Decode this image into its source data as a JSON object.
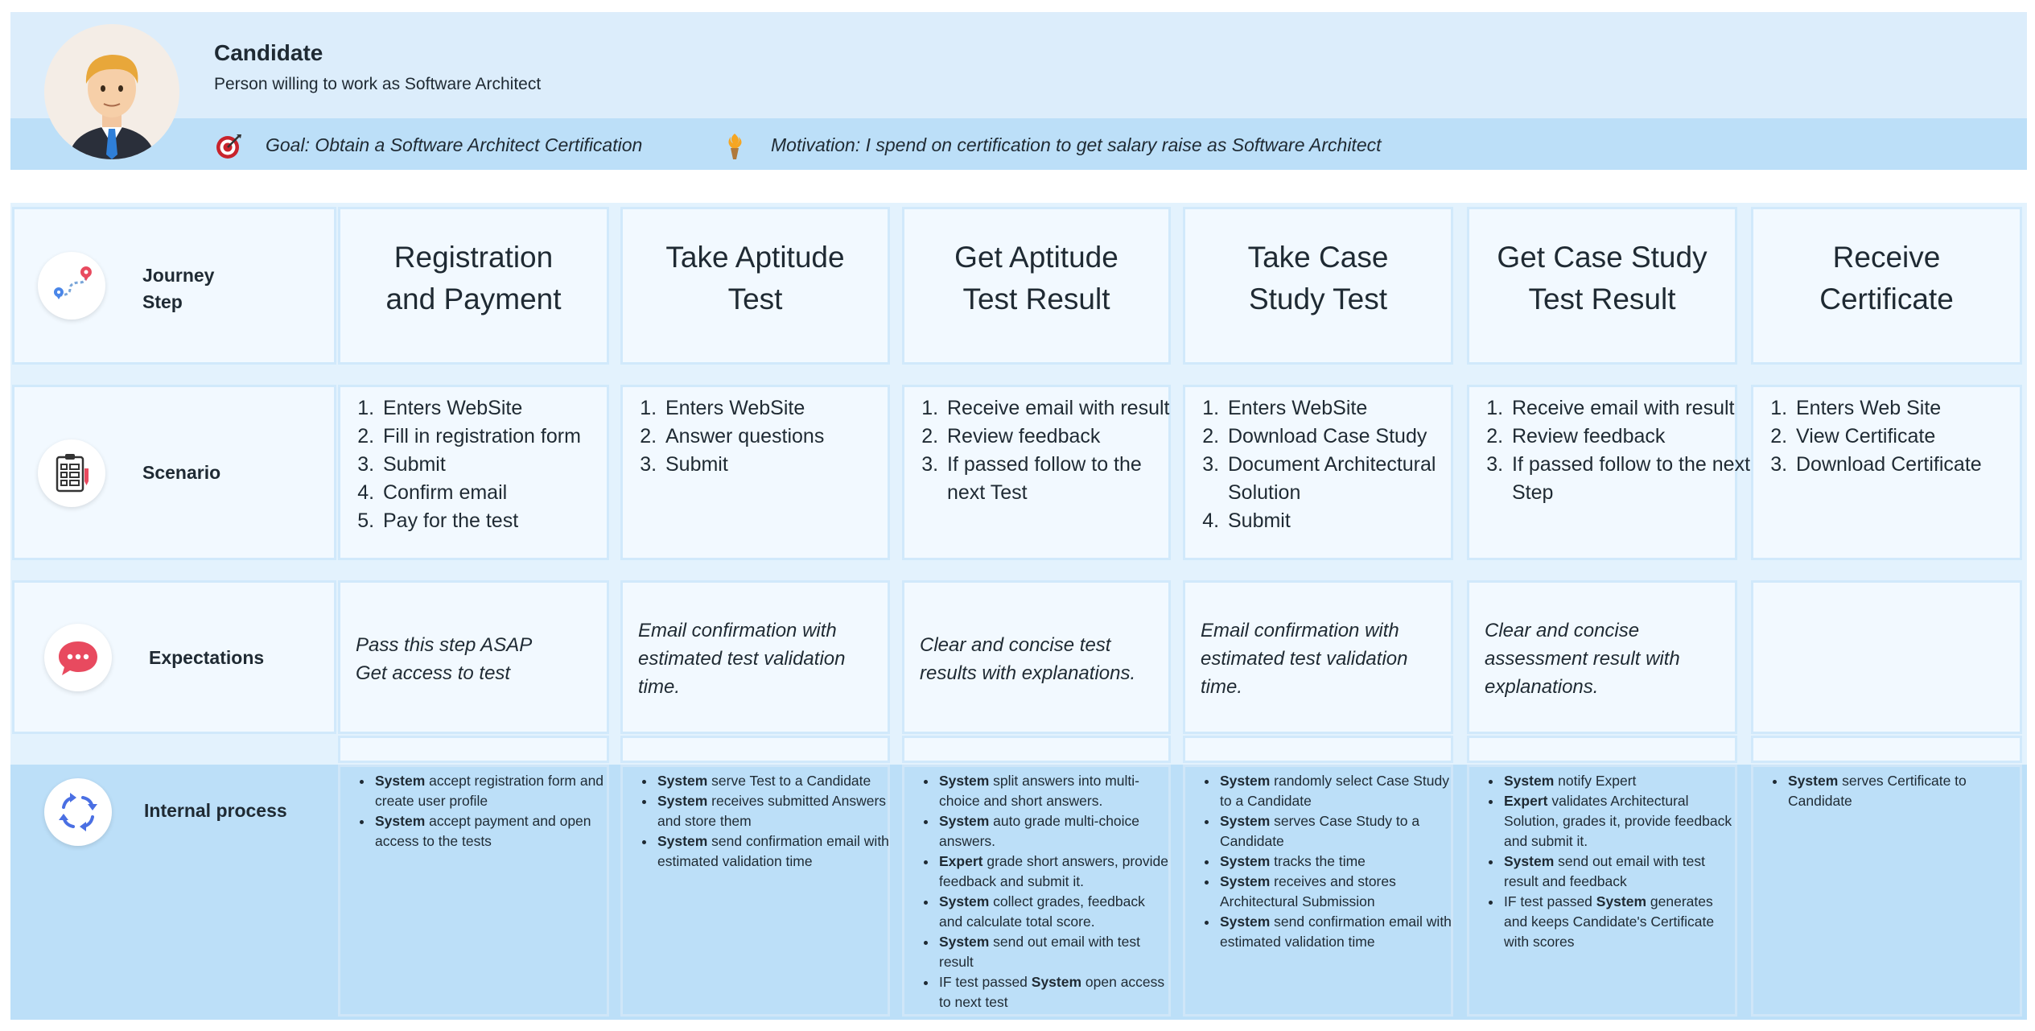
{
  "persona": {
    "name": "Candidate",
    "description": "Person willing to work as Software Architect",
    "goal": "Goal: Obtain a Software Architect Certification",
    "motivation": "Motivation: I spend on certification to get salary raise as Software Architect"
  },
  "row_labels": {
    "journey_step": "Journey\nStep",
    "scenario": "Scenario",
    "expectations": "Expectations",
    "internal_process": "Internal process"
  },
  "icons": {
    "journey": "route-map-pin-icon",
    "scenario": "checklist-icon",
    "expectations": "chat-bubble-icon",
    "process": "refresh-arrows-icon",
    "goal": "target-icon",
    "motivation": "torch-icon"
  },
  "colors": {
    "header_bg": "#dcedfb",
    "header_band": "#bcdff8",
    "cell_bg": "#f2f9ff",
    "process_bg": "#bcdff8",
    "accent_red": "#e84a5f",
    "accent_blue": "#4a86e8"
  },
  "steps": [
    {
      "title": "Registration\nand Payment",
      "scenario": [
        "Enters WebSite",
        "Fill in registration form",
        "Submit",
        "Confirm email",
        "Pay for the test"
      ],
      "expectation": "Pass this step ASAP\nGet access to test",
      "process": [
        [
          {
            "b": "System"
          },
          {
            "t": " accept registration form and create user profile"
          }
        ],
        [
          {
            "b": "System"
          },
          {
            "t": " accept payment and open access to the tests"
          }
        ]
      ]
    },
    {
      "title": "Take Aptitude\nTest",
      "scenario": [
        "Enters WebSite",
        "Answer questions",
        "Submit"
      ],
      "expectation": "Email confirmation with\nestimated test validation\ntime.",
      "process": [
        [
          {
            "b": "System"
          },
          {
            "t": " serve Test to a Candidate"
          }
        ],
        [
          {
            "b": "System"
          },
          {
            "t": " receives submitted Answers and store them"
          }
        ],
        [
          {
            "b": "System"
          },
          {
            "t": " send confirmation email with estimated validation time"
          }
        ]
      ]
    },
    {
      "title": "Get Aptitude\nTest Result",
      "scenario": [
        "Receive email with result",
        "Review feedback",
        "If passed follow to the next Test"
      ],
      "expectation": "Clear and concise test\nresults with explanations.",
      "process": [
        [
          {
            "b": "System"
          },
          {
            "t": " split answers into multi-choice and short answers."
          }
        ],
        [
          {
            "b": "System"
          },
          {
            "t": " auto grade multi-choice answers."
          }
        ],
        [
          {
            "b": "Expert"
          },
          {
            "t": " grade short answers, provide feedback and submit it."
          }
        ],
        [
          {
            "b": "System"
          },
          {
            "t": " collect grades, feedback and calculate total score."
          }
        ],
        [
          {
            "b": "System"
          },
          {
            "t": " send out email with test result"
          }
        ],
        [
          {
            "t": "IF test passed "
          },
          {
            "b": "System"
          },
          {
            "t": " open access to next test"
          }
        ]
      ]
    },
    {
      "title": "Take Case\nStudy Test",
      "scenario": [
        "Enters WebSite",
        "Download Case Study",
        "Document Architectural Solution",
        "Submit"
      ],
      "expectation": "Email confirmation with\nestimated test validation\ntime.",
      "process": [
        [
          {
            "b": "System"
          },
          {
            "t": " randomly select Case Study to a Candidate"
          }
        ],
        [
          {
            "b": "System"
          },
          {
            "t": " serves Case Study to a Candidate"
          }
        ],
        [
          {
            "b": "System"
          },
          {
            "t": " tracks the time"
          }
        ],
        [
          {
            "b": "System"
          },
          {
            "t": " receives and stores Architectural Submission"
          }
        ],
        [
          {
            "b": "System"
          },
          {
            "t": " send confirmation email with estimated validation time"
          }
        ]
      ]
    },
    {
      "title": "Get Case Study\nTest Result",
      "scenario": [
        "Receive email with result",
        "Review feedback",
        "If passed follow to the next Step"
      ],
      "expectation": "Clear and concise\nassessment result with\nexplanations.",
      "process": [
        [
          {
            "b": "System"
          },
          {
            "t": " notify Expert"
          }
        ],
        [
          {
            "b": "Expert"
          },
          {
            "t": " validates Architectural Solution, grades it, provide feedback and submit it."
          }
        ],
        [
          {
            "b": "System"
          },
          {
            "t": " send out email with test result and feedback"
          }
        ],
        [
          {
            "t": "IF test passed "
          },
          {
            "b": "System"
          },
          {
            "t": " generates and keeps Candidate's Certificate with scores"
          }
        ]
      ]
    },
    {
      "title": "Receive\nCertificate",
      "scenario": [
        "Enters Web Site",
        "View Certificate",
        "Download Certificate"
      ],
      "expectation": "",
      "process": [
        [
          {
            "b": "System"
          },
          {
            "t": " serves Certificate to Candidate"
          }
        ]
      ]
    }
  ]
}
